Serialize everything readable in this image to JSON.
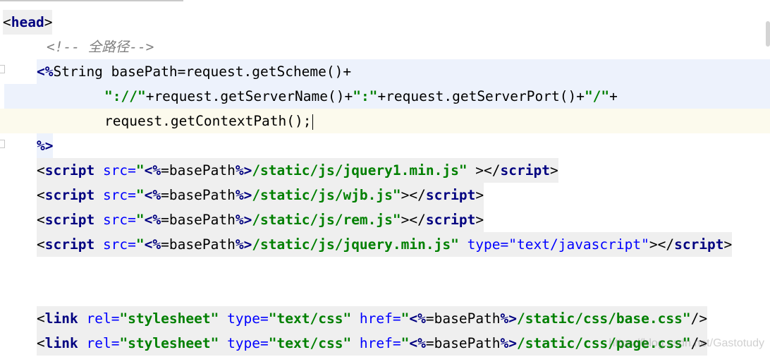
{
  "editor": {
    "head_open": {
      "lt": "<",
      "name": "head",
      "gt": ">"
    },
    "comment": "<!-- 全路径-->",
    "jsp_block": {
      "open": "<%",
      "line1": "String basePath=request.getScheme()+",
      "line2_q1": "\"://\"",
      "line2_mid": "+request.getServerName()+",
      "line2_q2": "\":\"",
      "line2_mid2": "+request.getServerPort()+",
      "line2_q3": "\"/\"",
      "line2_end": "+",
      "line3": "request.getContextPath();",
      "close": "%>"
    },
    "scripts": [
      {
        "lt": "<",
        "tag": "script",
        "attr": " src",
        "eq": "=",
        "q_open": "\"",
        "jsp_open": "<%",
        "expr": "=basePath",
        "jsp_close": "%>",
        "path": "/static/js/jquery1.min.js",
        "q_close": "\"",
        "rest": " ></",
        "close_tag": "script",
        "gt": ">",
        "extra": ""
      },
      {
        "lt": "<",
        "tag": "script",
        "attr": " src",
        "eq": "=",
        "q_open": "\"",
        "jsp_open": "<%",
        "expr": "=basePath",
        "jsp_close": "%>",
        "path": "/static/js/wjb.js",
        "q_close": "\"",
        "rest": "></",
        "close_tag": "script",
        "gt": ">",
        "extra": ""
      },
      {
        "lt": "<",
        "tag": "script",
        "attr": " src",
        "eq": "=",
        "q_open": "\"",
        "jsp_open": "<%",
        "expr": "=basePath",
        "jsp_close": "%>",
        "path": "/static/js/rem.js",
        "q_close": "\"",
        "rest": "></",
        "close_tag": "script",
        "gt": ">",
        "extra": ""
      },
      {
        "lt": "<",
        "tag": "script",
        "attr": " src",
        "eq": "=",
        "q_open": "\"",
        "jsp_open": "<%",
        "expr": "=basePath",
        "jsp_close": "%>",
        "path": "/static/js/jquery.min.js",
        "q_close": "\"",
        "rest": "></",
        "close_tag": "script",
        "gt": ">",
        "extra": " type=\"text/javascript\""
      }
    ],
    "links": [
      {
        "lt": "<",
        "tag": "link",
        "rel_attr": " rel",
        "rel_val": "\"stylesheet\"",
        "type_attr": " type",
        "type_val": "\"text/css\"",
        "href_attr": " href",
        "q_open": "\"",
        "jsp_open": "<%",
        "expr": "=basePath",
        "jsp_close": "%>",
        "path": "/static/css/base.css",
        "q_close": "\"",
        "end": "/>"
      },
      {
        "lt": "<",
        "tag": "link",
        "rel_attr": " rel",
        "rel_val": "\"stylesheet\"",
        "type_attr": " type",
        "type_val": "\"text/css\"",
        "href_attr": " href",
        "q_open": "\"",
        "jsp_open": "<%",
        "expr": "=basePath",
        "jsp_close": "%>",
        "path": "/static/css/page.css",
        "q_close": "\"",
        "end": "/>"
      }
    ]
  },
  "watermark": "https://blog.csdn.net/Gastotudy"
}
